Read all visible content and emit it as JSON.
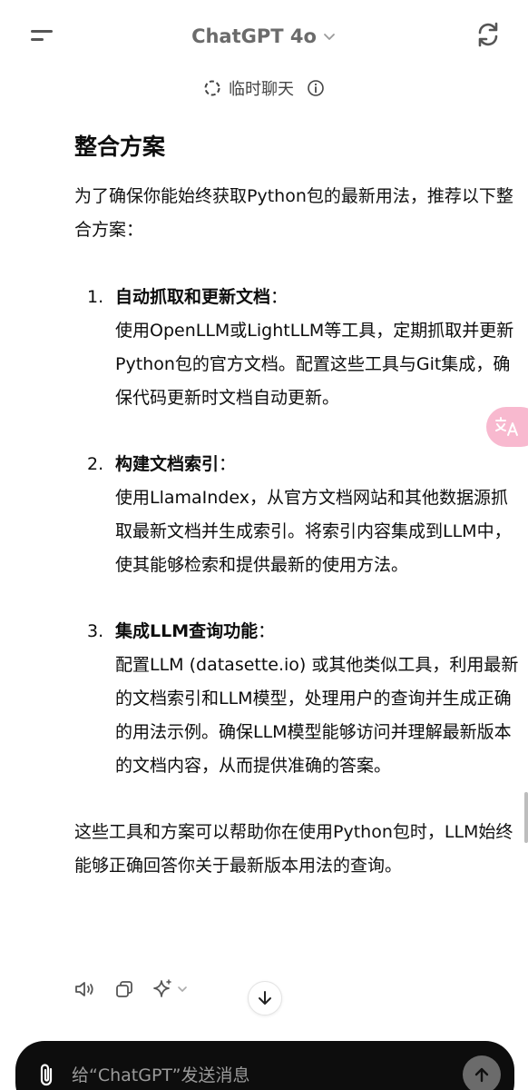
{
  "header": {
    "model_name": "ChatGPT 4o",
    "temp_chat_label": "临时聊天"
  },
  "content": {
    "heading": "整合方案",
    "intro": "为了确保你能始终获取Python包的最新用法，推荐以下整合方案：",
    "items": [
      {
        "number": "1.",
        "title": "自动抓取和更新文档",
        "colon": "：",
        "body": "使用OpenLLM或LightLLM等工具，定期抓取并更新Python包的官方文档。配置这些工具与Git集成，确保代码更新时文档自动更新。"
      },
      {
        "number": "2.",
        "title": "构建文档索引",
        "colon": "：",
        "body": "使用LlamaIndex，从官方文档网站和其他数据源抓取最新文档并生成索引。将索引内容集成到LLM中，使其能够检索和提供最新的使用方法。"
      },
      {
        "number": "3.",
        "title": "集成LLM查询功能",
        "colon": "：",
        "body": "配置LLM (datasette.io) 或其他类似工具，利用最新的文档索引和LLM模型，处理用户的查询并生成正确的用法示例。确保LLM模型能够访问并理解最新版本的文档内容，从而提供准确的答案。"
      }
    ],
    "outro": "这些工具和方案可以帮助你在使用Python包时，LLM始终能够正确回答你关于最新版本用法的查询。"
  },
  "composer": {
    "placeholder": "给“ChatGPT”发送消息"
  },
  "icons": {
    "menu": "menu-icon",
    "chevron": "chevron-down-icon",
    "refresh": "refresh-icon",
    "temp_chat": "dashed-circle-icon",
    "info": "info-icon",
    "read_aloud": "speaker-icon",
    "copy": "copy-icon",
    "regenerate": "sparkle-icon",
    "scroll_down": "arrow-down-icon",
    "translate": "translate-icon",
    "attach": "paperclip-icon",
    "send": "arrow-up-icon"
  },
  "colors": {
    "composer_bg": "#0d0d0d",
    "send_bg": "#6b6b6b",
    "translate_fab": "#f8b9cf"
  }
}
